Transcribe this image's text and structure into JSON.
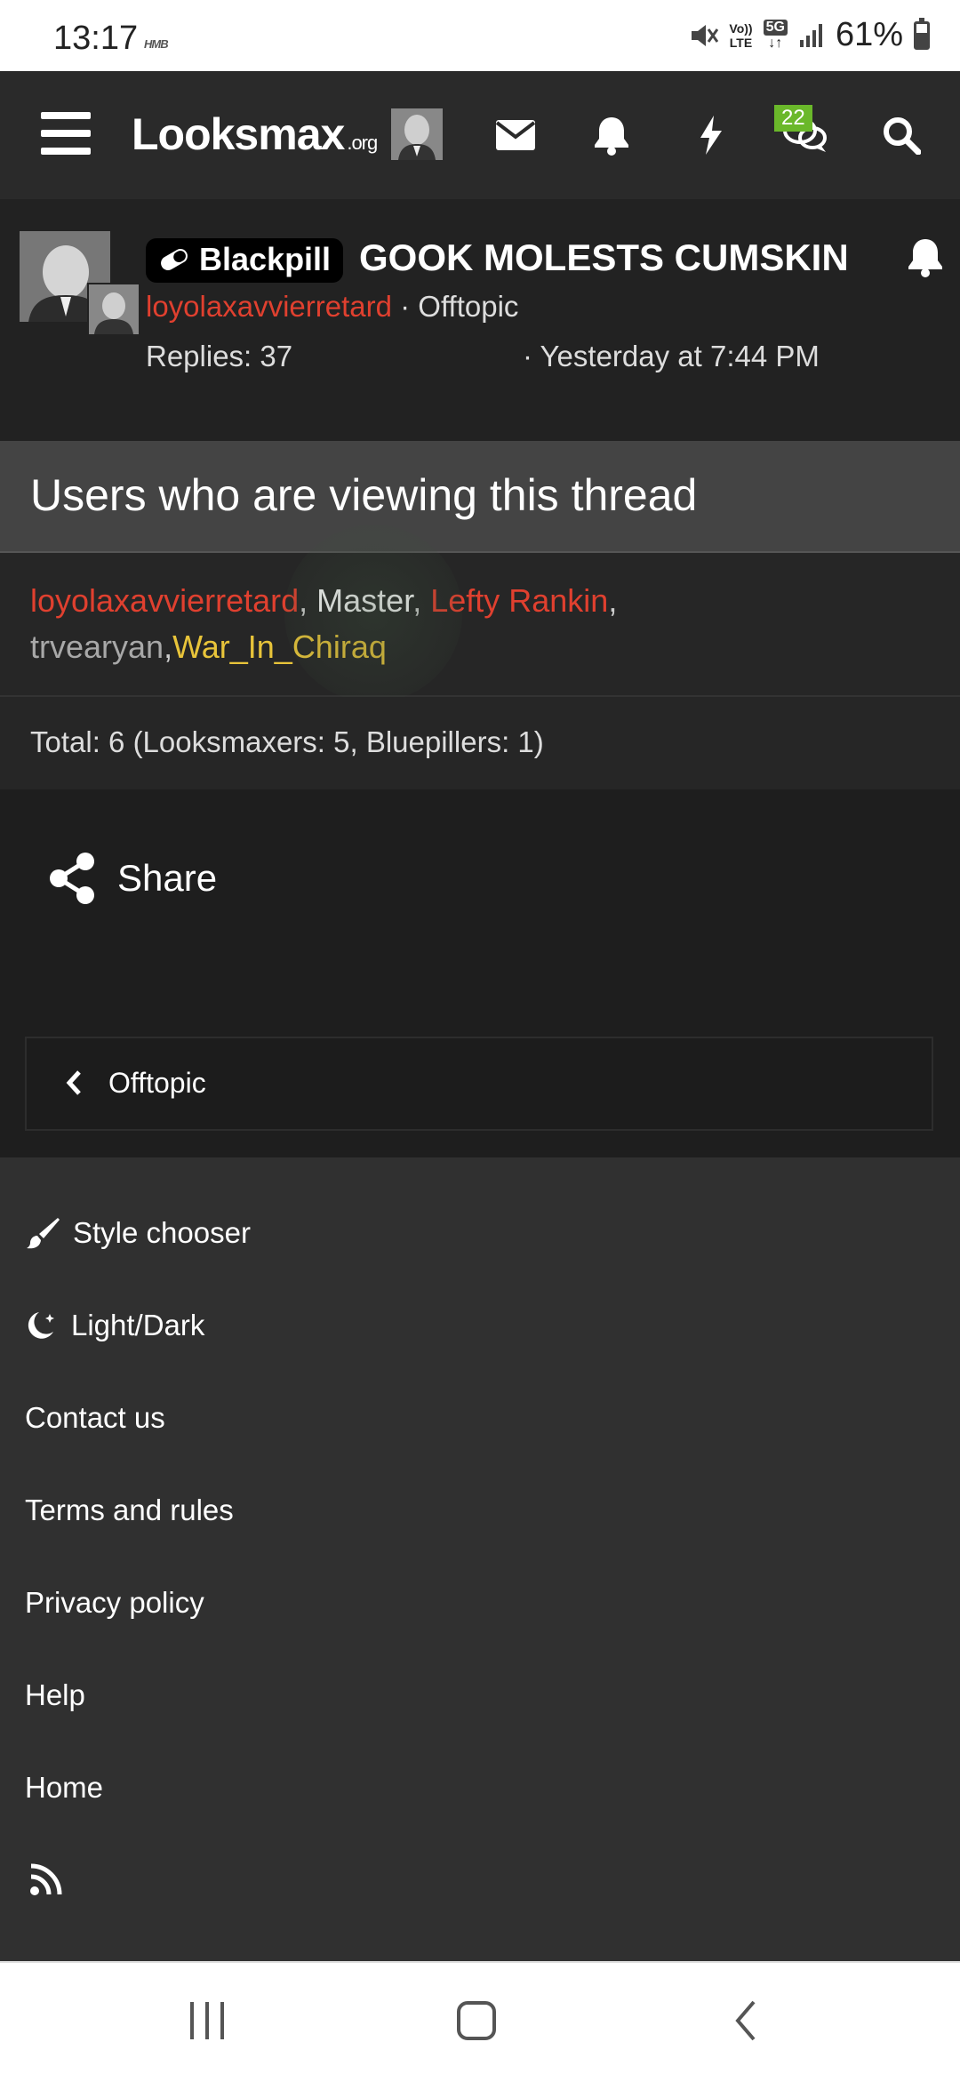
{
  "status_bar": {
    "time": "13:17",
    "carrier_mark": "HMB",
    "volte": "Vo)) LTE",
    "network": "5G",
    "battery": "61%",
    "battery_level": 0.61
  },
  "nav": {
    "logo_main": "Looksmax",
    "logo_suffix": ".org",
    "conversations_badge": "22",
    "icons": [
      "menu-icon",
      "envelope-icon",
      "bell-icon",
      "lightning-icon",
      "chat-bubbles-icon",
      "search-icon"
    ]
  },
  "thread": {
    "prefix": "Blackpill",
    "title": "GOOK MOLESTS CUMSKIN",
    "author": "loyolaxavvierretard",
    "forum_sep": " · Offtopic",
    "replies": "Replies: 37",
    "date": "· Yesterday at 7:44 PM"
  },
  "viewers": {
    "heading": "Users who are viewing this thread",
    "users": [
      {
        "name": "loyolaxavvierretard",
        "color": "#e0402f",
        "sep": ", "
      },
      {
        "name": "Master",
        "color": "#ffffff",
        "sep": ", "
      },
      {
        "name": "Lefty Rankin",
        "color": "#e0402f",
        "sep": ", "
      },
      {
        "name": "trvearyan",
        "color": "#a8a8a8",
        "sep": ","
      },
      {
        "name": "War_In_Chiraq",
        "color": "#e8c43a",
        "sep": ""
      }
    ],
    "total": "Total: 6 (Looksmaxers: 5, Bluepillers: 1)"
  },
  "share_label": "Share",
  "back_link": "Offtopic",
  "footer": {
    "style_chooser": "Style chooser",
    "light_dark": "Light/Dark",
    "contact": "Contact us",
    "terms": "Terms and rules",
    "privacy": "Privacy policy",
    "help": "Help",
    "home": "Home"
  }
}
